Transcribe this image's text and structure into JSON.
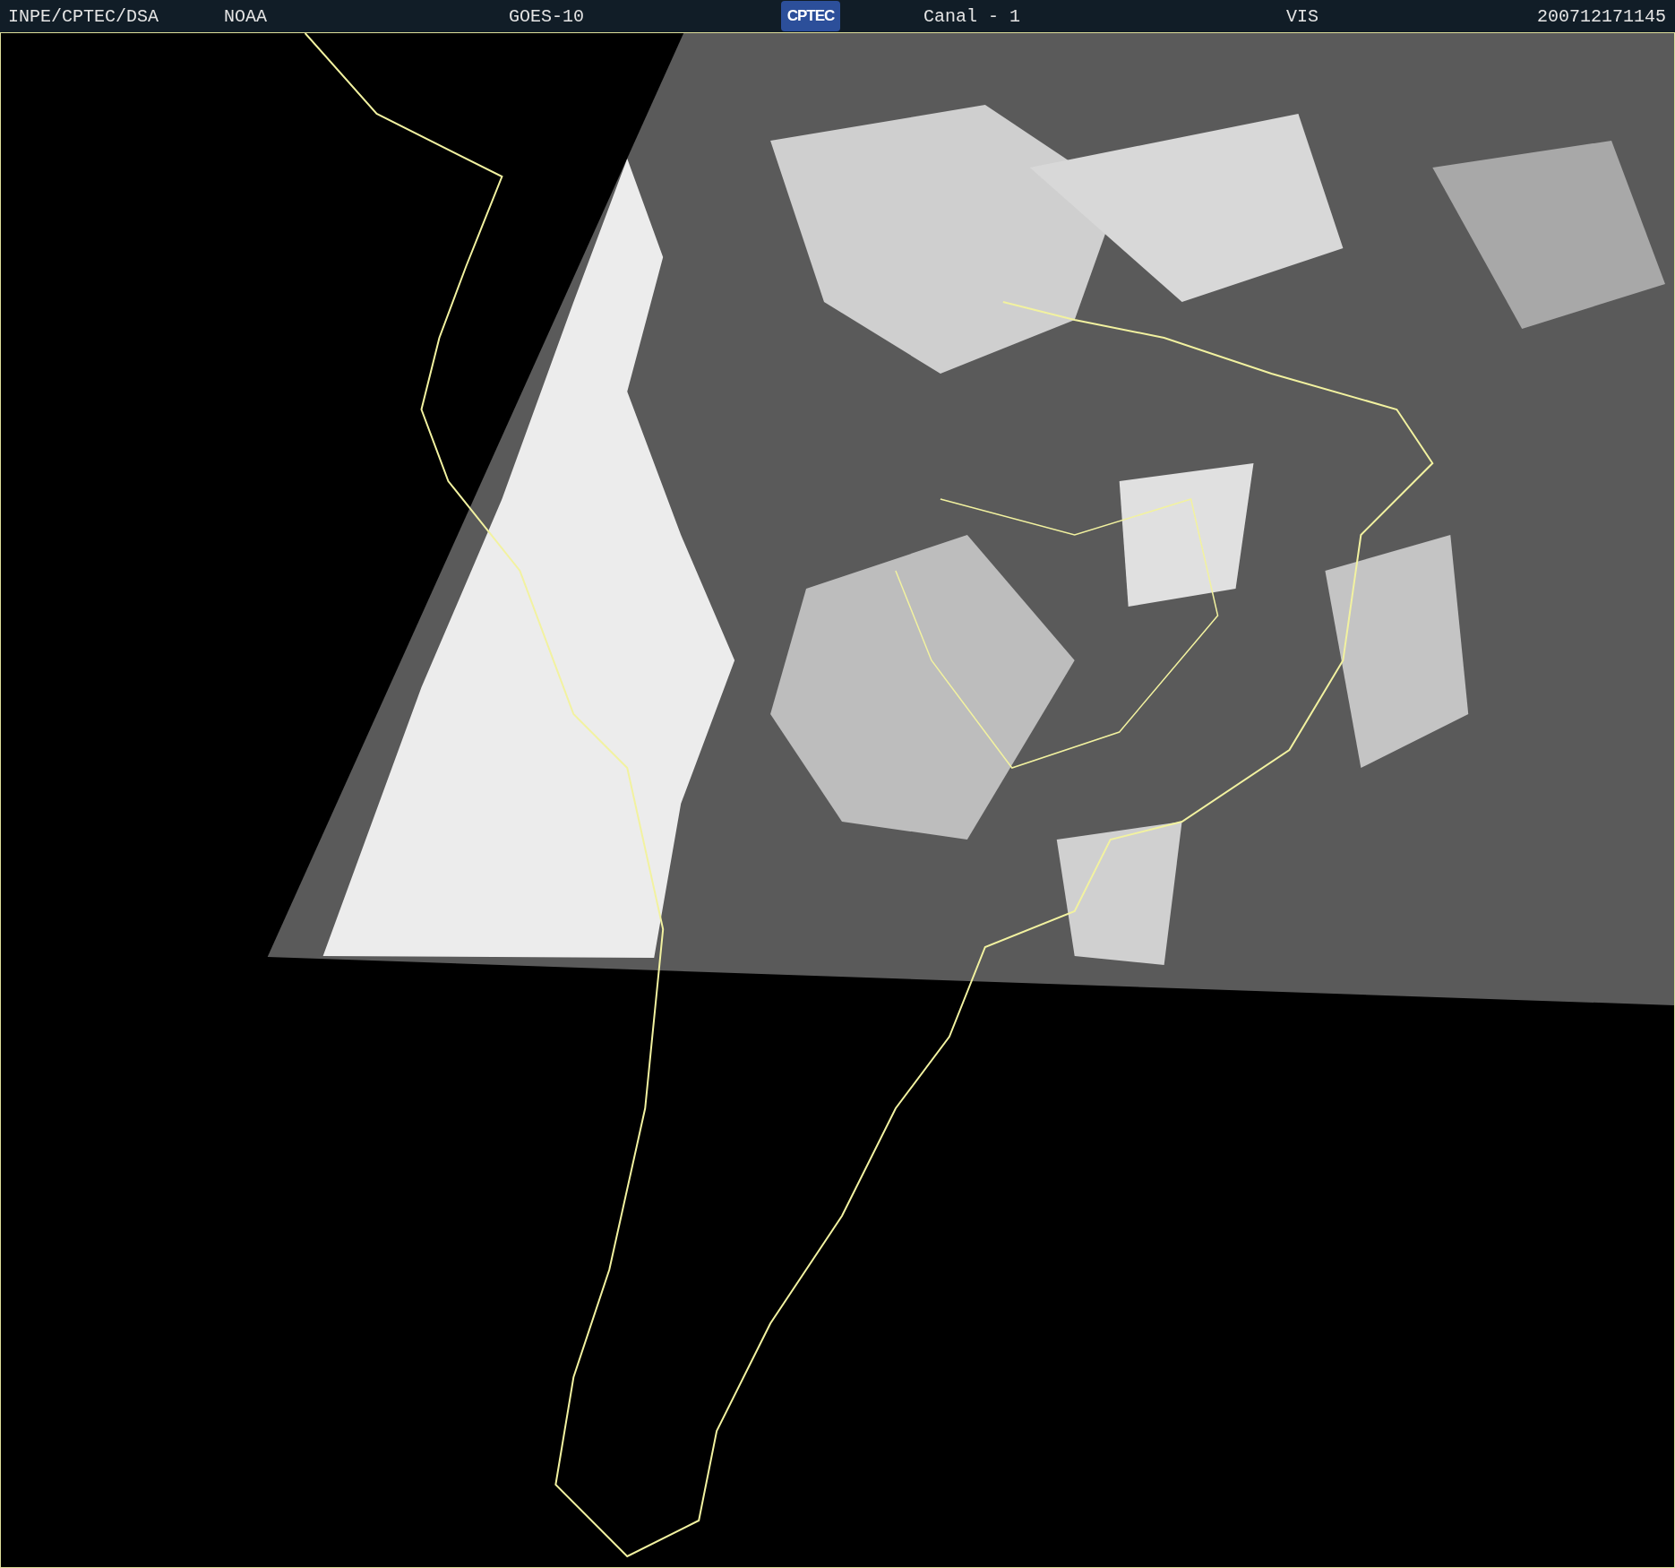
{
  "header": {
    "source": "INPE/CPTEC/DSA",
    "agency": "NOAA",
    "satellite": "GOES-10",
    "logo": "CPTEC",
    "channel": "Canal - 1",
    "band": "VIS",
    "timestamp": "200712171145"
  }
}
